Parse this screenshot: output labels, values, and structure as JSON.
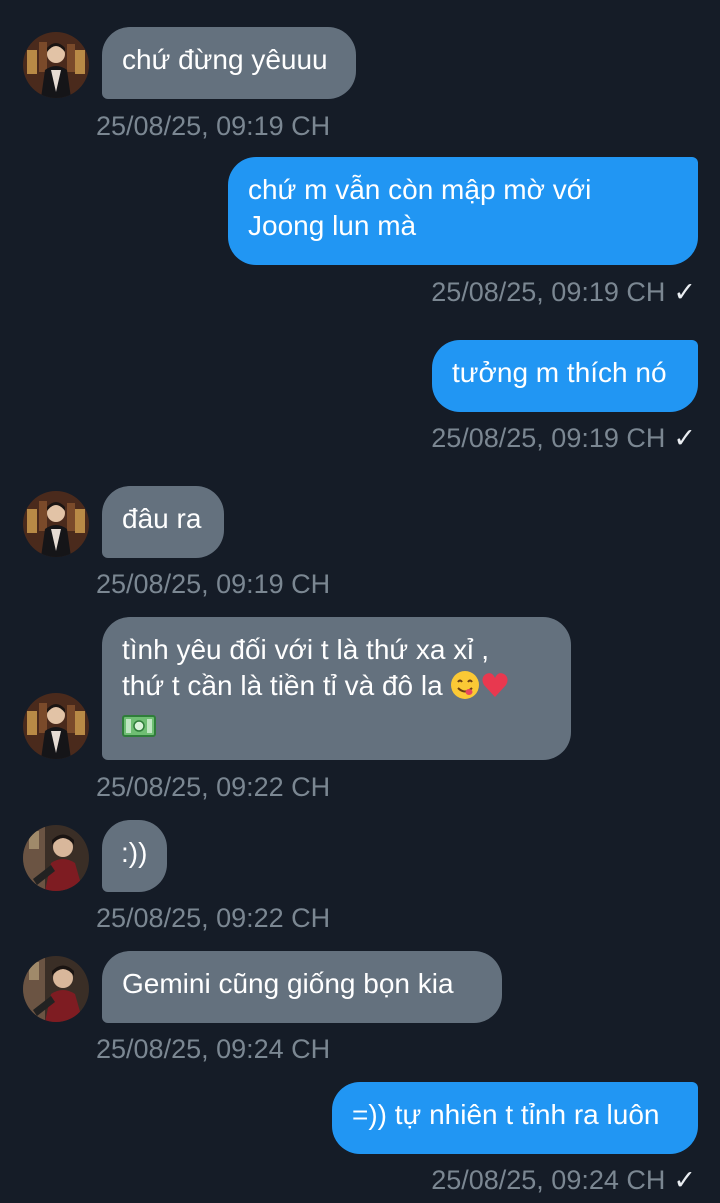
{
  "conversation": {
    "messages": [
      {
        "side": "in",
        "text": "chứ đừng yêuuu",
        "time": "25/08/25, 09:19 CH"
      },
      {
        "side": "out",
        "lines": [
          "chứ m vẫn còn mập mờ với",
          "Joong lun mà"
        ],
        "time": "25/08/25, 09:19 CH",
        "status": "✓"
      },
      {
        "side": "out",
        "text": "tưởng m thích nó",
        "time": "25/08/25, 09:19 CH",
        "status": "✓"
      },
      {
        "side": "in",
        "text": "đâu ra",
        "time": "25/08/25, 09:19 CH"
      },
      {
        "side": "in",
        "lines": [
          "tình yêu đối với t là thứ xa xỉ ,",
          "thứ t cần là tiền tỉ và đô la"
        ],
        "time": "25/08/25, 09:22 CH",
        "emojis": [
          "yum-face-emoji",
          "red-heart-emoji",
          "dollar-banknote-emoji"
        ]
      },
      {
        "side": "in",
        "text": ":))",
        "time": "25/08/25, 09:22 CH"
      },
      {
        "side": "in",
        "text": "Gemini cũng giống bọn kia",
        "time": "25/08/25, 09:24 CH"
      },
      {
        "side": "out",
        "text": "=)) tự nhiên t tỉnh ra luôn",
        "time": "25/08/25, 09:24 CH",
        "status": "✓"
      }
    ]
  },
  "colors": {
    "background": "#151c27",
    "incoming_bubble": "#64717e",
    "outgoing_bubble": "#2196f3",
    "timestamp": "#7b8792"
  }
}
